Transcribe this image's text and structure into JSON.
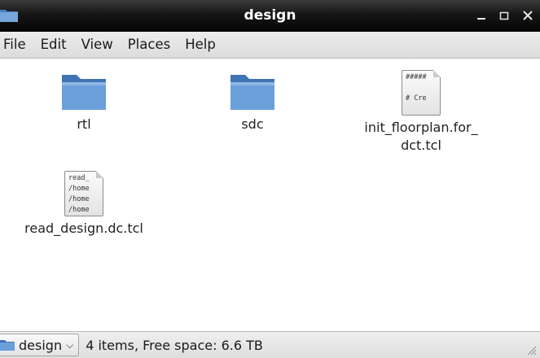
{
  "window": {
    "title": "design"
  },
  "menu": [
    "File",
    "Edit",
    "View",
    "Places",
    "Help"
  ],
  "files": [
    {
      "name": "rtl",
      "type": "folder"
    },
    {
      "name": "sdc",
      "type": "folder"
    },
    {
      "name": "init_floorplan.for_\ndct.tcl",
      "type": "text-file",
      "preview": "#####\n\n# Cre"
    },
    {
      "name": "read_design.dc.tcl",
      "type": "text-file",
      "preview": "read_\n/home\n/home\n/home"
    }
  ],
  "status": {
    "location": "design",
    "text": "4 items, Free space: 6.6 TB"
  },
  "colors": {
    "folder": "#5b8fc9",
    "titlebar": "#1a1a1a"
  }
}
